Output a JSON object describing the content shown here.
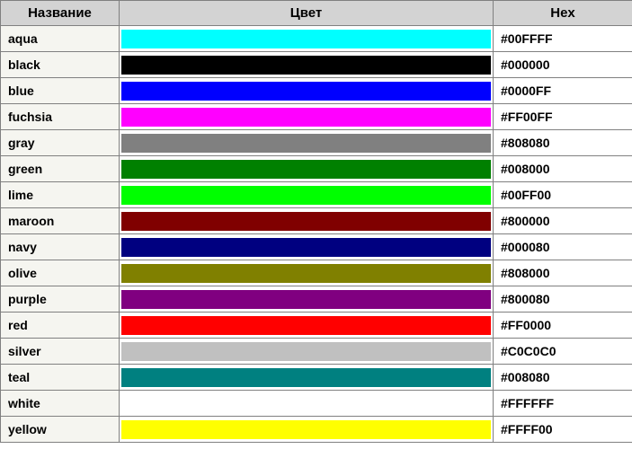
{
  "headers": {
    "name": "Название",
    "color": "Цвет",
    "hex": "Hex"
  },
  "rows": [
    {
      "name": "aqua",
      "hex": "#00FFFF",
      "swatch": "#00FFFF"
    },
    {
      "name": "black",
      "hex": "#000000",
      "swatch": "#000000"
    },
    {
      "name": "blue",
      "hex": "#0000FF",
      "swatch": "#0000FF"
    },
    {
      "name": "fuchsia",
      "hex": "#FF00FF",
      "swatch": "#FF00FF"
    },
    {
      "name": "gray",
      "hex": "#808080",
      "swatch": "#808080"
    },
    {
      "name": "green",
      "hex": "#008000",
      "swatch": "#008000"
    },
    {
      "name": "lime",
      "hex": "#00FF00",
      "swatch": "#00FF00"
    },
    {
      "name": "maroon",
      "hex": "#800000",
      "swatch": "#800000"
    },
    {
      "name": "navy",
      "hex": "#000080",
      "swatch": "#000080"
    },
    {
      "name": "olive",
      "hex": "#808000",
      "swatch": "#808000"
    },
    {
      "name": "purple",
      "hex": "#800080",
      "swatch": "#800080"
    },
    {
      "name": "red",
      "hex": "#FF0000",
      "swatch": "#FF0000"
    },
    {
      "name": "silver",
      "hex": "#C0C0C0",
      "swatch": "#C0C0C0"
    },
    {
      "name": "teal",
      "hex": "#008080",
      "swatch": "#008080"
    },
    {
      "name": "white",
      "hex": "#FFFFFF",
      "swatch": "#FFFFFF"
    },
    {
      "name": "yellow",
      "hex": "#FFFF00",
      "swatch": "#FFFF00"
    }
  ]
}
